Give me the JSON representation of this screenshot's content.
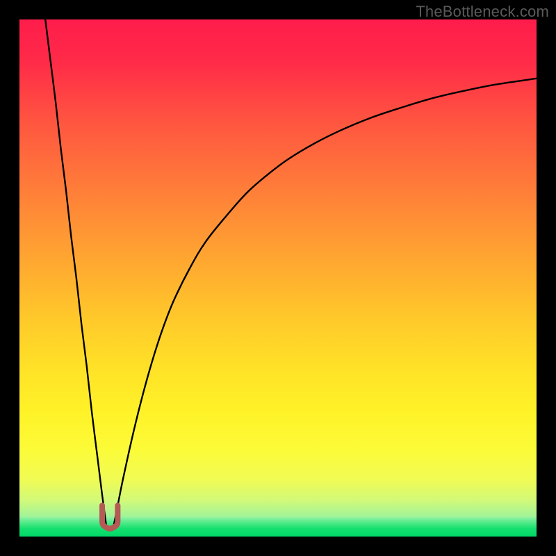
{
  "watermark": "TheBottleneck.com",
  "chart_data": {
    "type": "line",
    "title": "",
    "xlabel": "",
    "ylabel": "",
    "xlim": [
      0,
      100
    ],
    "ylim": [
      0,
      100
    ],
    "grid": false,
    "background": "rainbow-vertical",
    "series": [
      {
        "name": "curve-left",
        "x": [
          5,
          6,
          7,
          8,
          9,
          10,
          11,
          12,
          13,
          14,
          15,
          16,
          16.8
        ],
        "y": [
          100,
          92,
          84,
          75,
          67,
          58,
          50,
          41,
          33,
          24,
          16,
          8,
          2
        ]
      },
      {
        "name": "curve-right",
        "x": [
          18.2,
          19,
          20,
          22,
          24,
          26,
          28,
          30,
          33,
          36,
          40,
          44,
          48,
          52,
          57,
          62,
          68,
          74,
          80,
          86,
          92,
          98,
          100
        ],
        "y": [
          2,
          6,
          11,
          20,
          28,
          35,
          41,
          46,
          52,
          57,
          62,
          66.5,
          70,
          73,
          76,
          78.5,
          81,
          83,
          84.8,
          86.2,
          87.4,
          88.3,
          88.6
        ]
      },
      {
        "name": "valley-marker",
        "type": "marker",
        "shape": "u",
        "color": "#b55a54",
        "x": 17.5,
        "y": 2,
        "width_x": 3,
        "height_y": 4
      }
    ],
    "green_band": {
      "y_from": 0,
      "y_to": 3.7
    }
  }
}
